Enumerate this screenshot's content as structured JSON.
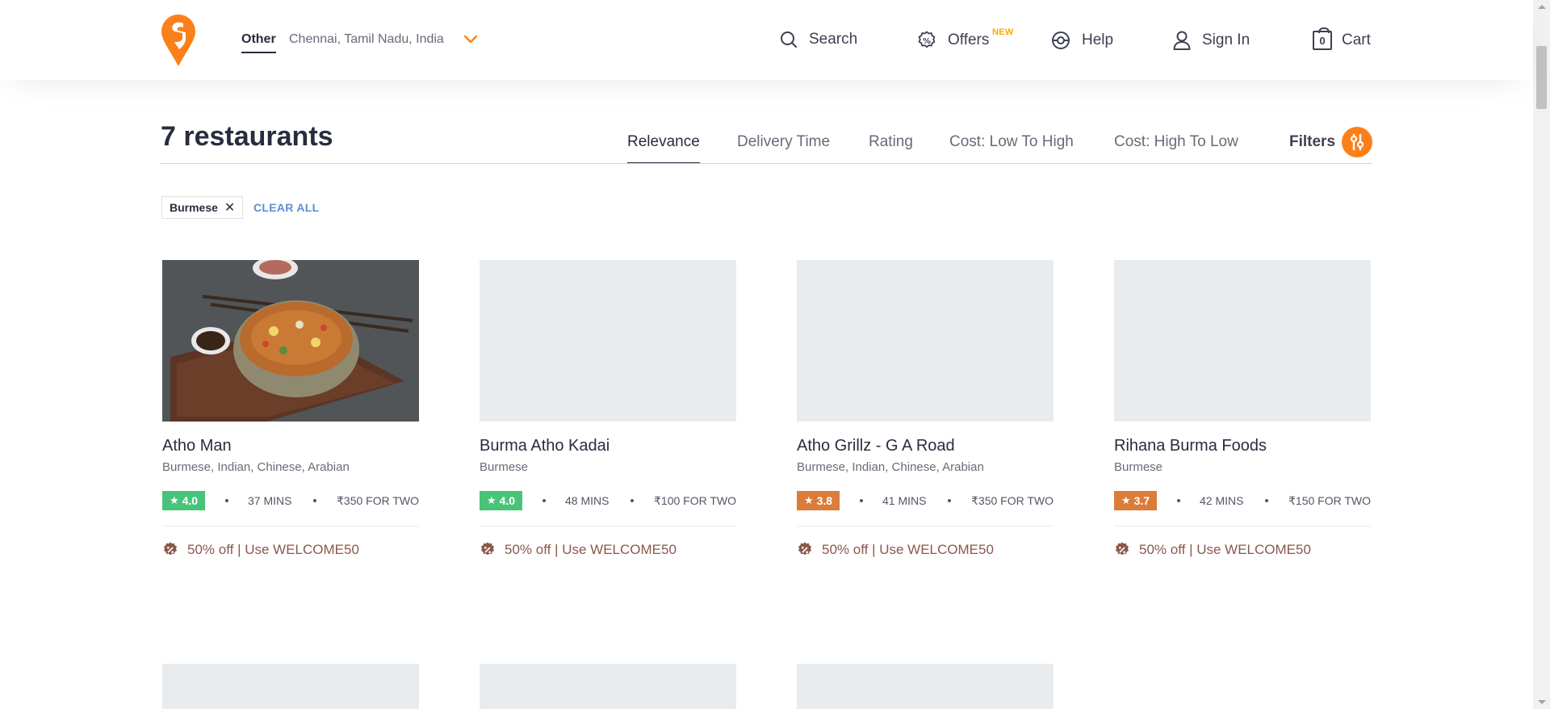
{
  "header": {
    "location_label": "Other",
    "location_text": "Chennai, Tamil Nadu, India",
    "nav": {
      "search": "Search",
      "offers": "Offers",
      "offers_badge": "NEW",
      "help": "Help",
      "signin": "Sign In",
      "cart": "Cart",
      "cart_count": "0"
    }
  },
  "listing": {
    "title": "7 restaurants",
    "sort_options": [
      "Relevance",
      "Delivery Time",
      "Rating",
      "Cost: Low To High",
      "Cost: High To Low"
    ],
    "active_sort": "Relevance",
    "filters_label": "Filters"
  },
  "applied_filters": {
    "chips": [
      "Burmese"
    ],
    "clear_all": "CLEAR ALL"
  },
  "restaurants": [
    {
      "name": "Atho Man",
      "cuisines": "Burmese, Indian, Chinese, Arabian",
      "rating": "4.0",
      "rating_color": "#48c479",
      "delivery_time": "37 MINS",
      "cost": "₹350 FOR TWO",
      "offer": "50% off | Use WELCOME50"
    },
    {
      "name": "Burma Atho Kadai",
      "cuisines": "Burmese",
      "rating": "4.0",
      "rating_color": "#48c479",
      "delivery_time": "48 MINS",
      "cost": "₹100 FOR TWO",
      "offer": "50% off | Use WELCOME50"
    },
    {
      "name": "Atho Grillz - G A Road",
      "cuisines": "Burmese, Indian, Chinese, Arabian",
      "rating": "3.8",
      "rating_color": "#db7c38",
      "delivery_time": "41 MINS",
      "cost": "₹350 FOR TWO",
      "offer": "50% off | Use WELCOME50"
    },
    {
      "name": "Rihana Burma Foods",
      "cuisines": "Burmese",
      "rating": "3.7",
      "rating_color": "#db7c38",
      "delivery_time": "42 MINS",
      "cost": "₹150 FOR TWO",
      "offer": "50% off | Use WELCOME50"
    }
  ],
  "colors": {
    "brand_orange": "#fc8019",
    "badge_new": "#ffa700",
    "link_blue": "#5d8ed5",
    "offer_brown": "#8a584b"
  }
}
